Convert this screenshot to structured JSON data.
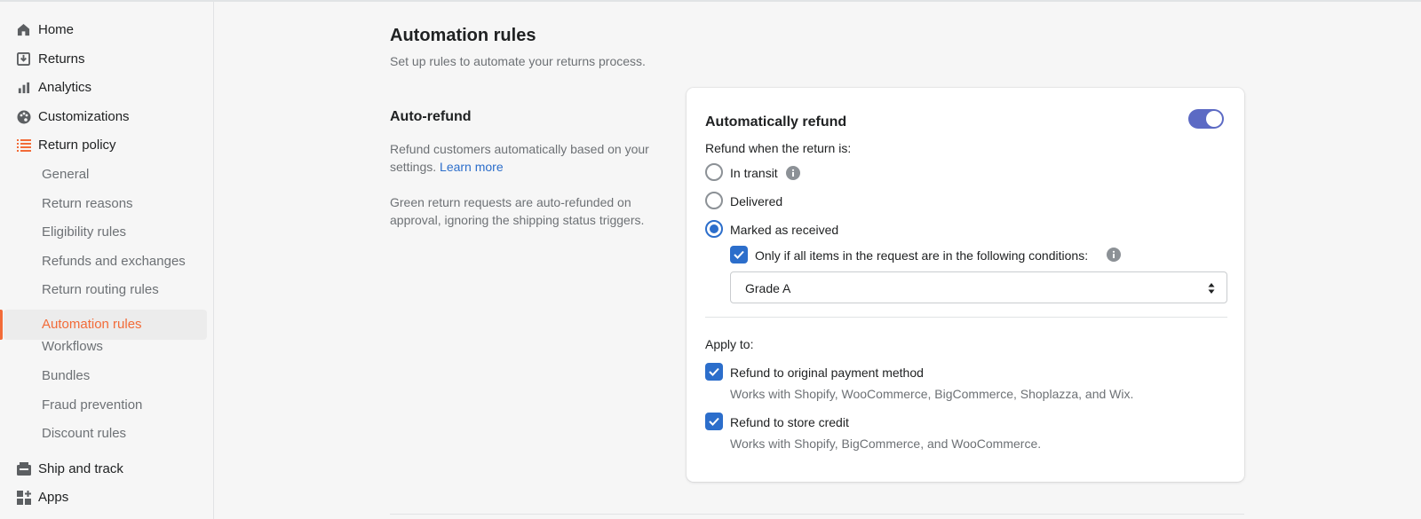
{
  "sidebar": {
    "items": [
      {
        "label": "Home",
        "icon": "home-icon"
      },
      {
        "label": "Returns",
        "icon": "returns-icon"
      },
      {
        "label": "Analytics",
        "icon": "analytics-icon"
      },
      {
        "label": "Customizations",
        "icon": "palette-icon"
      },
      {
        "label": "Return policy",
        "icon": "list-icon"
      }
    ],
    "sub_items": [
      {
        "label": "General"
      },
      {
        "label": "Return reasons"
      },
      {
        "label": "Eligibility rules"
      },
      {
        "label": "Refunds and exchanges"
      },
      {
        "label": "Return routing rules"
      },
      {
        "label": "Automation rules",
        "active": true
      },
      {
        "label": "Workflows"
      },
      {
        "label": "Bundles"
      },
      {
        "label": "Fraud prevention"
      },
      {
        "label": "Discount rules"
      }
    ],
    "bottom_items": [
      {
        "label": "Ship and track",
        "icon": "shipping-icon"
      },
      {
        "label": "Apps",
        "icon": "apps-icon"
      }
    ],
    "active_color": "#f26b38"
  },
  "page": {
    "title": "Automation rules",
    "subtitle": "Set up rules to automate your returns process."
  },
  "section": {
    "title": "Auto-refund",
    "desc1": "Refund customers automatically based on your settings.",
    "learn_more": "Learn more",
    "desc2": "Green return requests are auto-refunded on approval, ignoring the shipping status triggers."
  },
  "card": {
    "title": "Automatically refund",
    "toggle_on": true,
    "refund_when_label": "Refund when the return is:",
    "options": [
      {
        "label": "In transit",
        "checked": false
      },
      {
        "label": "Delivered",
        "checked": false
      },
      {
        "label": "Marked as received",
        "checked": true
      }
    ],
    "condition_label": "Only if all items in the request are in the following conditions:",
    "condition_checked": true,
    "select_value": "Grade A",
    "apply_to_label": "Apply to:",
    "apply_options": [
      {
        "label": "Refund to original payment method",
        "desc": "Works with Shopify, WooCommerce, BigCommerce, Shoplazza, and Wix.",
        "checked": true
      },
      {
        "label": "Refund to store credit",
        "desc": "Works with Shopify, BigCommerce, and WooCommerce.",
        "checked": true
      }
    ]
  },
  "colors": {
    "accent_blue": "#2c6ecb",
    "toggle": "#5c6ac4"
  }
}
